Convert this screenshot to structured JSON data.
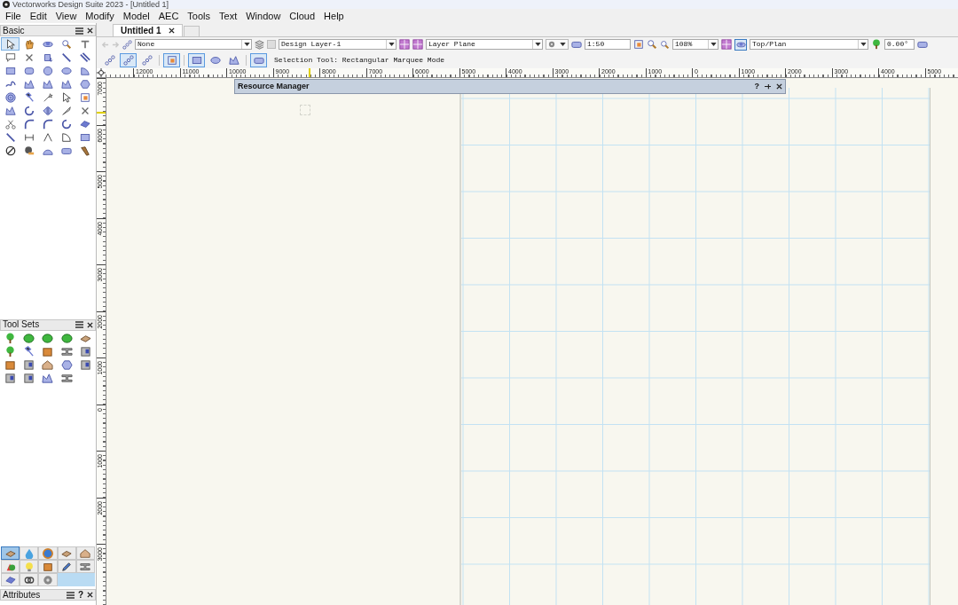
{
  "window": {
    "title": "Vectorworks Design Suite 2023 - [Untitled 1]"
  },
  "menu": [
    "File",
    "Edit",
    "View",
    "Modify",
    "Model",
    "AEC",
    "Tools",
    "Text",
    "Window",
    "Cloud",
    "Help"
  ],
  "basic_palette": {
    "title": "Basic",
    "tools": [
      {
        "selected": true
      },
      {
        "selected": false
      },
      {
        "selected": false
      },
      {
        "selected": false
      },
      {
        "selected": false
      },
      {
        "selected": false
      },
      {
        "selected": false
      },
      {
        "selected": false
      },
      {
        "selected": false
      },
      {
        "selected": false
      },
      {
        "selected": false
      },
      {
        "selected": false
      },
      {
        "selected": false
      },
      {
        "selected": false
      },
      {
        "selected": false
      },
      {
        "selected": false
      },
      {
        "selected": false
      },
      {
        "selected": false
      },
      {
        "selected": false
      },
      {
        "selected": false
      },
      {
        "selected": false
      },
      {
        "selected": false
      },
      {
        "selected": false
      },
      {
        "selected": false
      },
      {
        "selected": false
      },
      {
        "selected": false
      },
      {
        "selected": false
      },
      {
        "selected": false
      },
      {
        "selected": false
      },
      {
        "selected": false
      },
      {
        "selected": false
      },
      {
        "selected": false
      },
      {
        "selected": false
      },
      {
        "selected": false
      },
      {
        "selected": false
      },
      {
        "selected": false
      },
      {
        "selected": false
      },
      {
        "selected": false
      },
      {
        "selected": false
      },
      {
        "selected": false
      },
      {
        "selected": false
      },
      {
        "selected": false
      },
      {
        "selected": false
      },
      {
        "selected": false
      },
      {
        "selected": false
      }
    ]
  },
  "tool_sets_palette": {
    "title": "Tool Sets"
  },
  "palette_tabs": [
    {
      "selected": true
    },
    {
      "selected": false
    },
    {
      "selected": false
    },
    {
      "selected": false
    },
    {
      "selected": false
    },
    {
      "selected": false
    },
    {
      "selected": false
    },
    {
      "selected": false
    },
    {
      "selected": false
    },
    {
      "selected": false
    },
    {
      "selected": false
    },
    {
      "selected": false
    },
    {
      "selected": false
    }
  ],
  "attributes_palette": {
    "title": "Attributes",
    "help": "?"
  },
  "document_tabs": [
    {
      "label": "Untitled 1",
      "selected": true
    }
  ],
  "view_bar": {
    "class": "None",
    "layer": "Design Layer-1",
    "plane": "Layer Plane",
    "scale": "1:50",
    "zoom": "108%",
    "view": "Top/Plan",
    "rotation": "0.00°"
  },
  "mode_bar": {
    "modes": [
      {
        "selected": false
      },
      {
        "selected": true
      },
      {
        "selected": false
      },
      {
        "selected": true
      },
      {
        "selected": true
      },
      {
        "selected": false
      },
      {
        "selected": false
      },
      {
        "selected": true
      }
    ],
    "status": "Selection Tool: Rectangular Marquee Mode"
  },
  "rulers": {
    "horizontal": [
      "12000",
      "11000",
      "10000",
      "9000",
      "8000",
      "7000",
      "6000",
      "5000",
      "4000",
      "3000",
      "2000",
      "1000",
      "0",
      "1000",
      "2000",
      "3000",
      "4000",
      "5000"
    ],
    "vertical": [
      "7000",
      "6000",
      "5000",
      "4000",
      "3000",
      "2000",
      "1000",
      "0",
      "1000",
      "2000",
      "3000"
    ]
  },
  "resource_manager": {
    "title": "Resource Manager",
    "help": "?"
  }
}
